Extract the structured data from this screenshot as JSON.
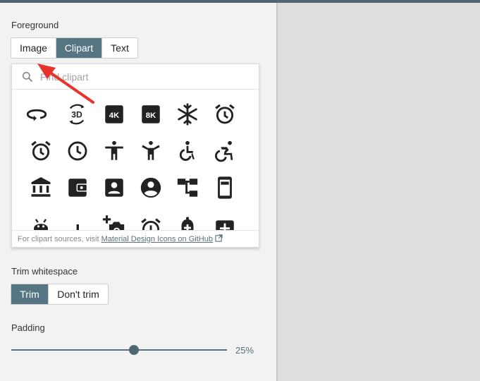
{
  "foreground": {
    "label": "Foreground",
    "tabs": [
      "Image",
      "Clipart",
      "Text"
    ],
    "active_tab": "Clipart"
  },
  "clipart": {
    "search_placeholder": "Find clipart",
    "icons": [
      "360-icon",
      "3d-rotation-icon",
      "4k-icon",
      "8k-icon",
      "ac-unit-icon",
      "access-alarm-icon",
      "access-alarms-icon",
      "access-time-icon",
      "accessibility-icon",
      "accessibility-new-icon",
      "accessible-icon",
      "accessible-forward-icon",
      "account-balance-icon",
      "account-balance-wallet-icon",
      "account-box-icon",
      "account-circle-icon",
      "account-tree-icon",
      "ad-units-icon",
      "adb-icon",
      "add-icon",
      "add-a-photo-icon",
      "add-alarm-icon",
      "add-alert-icon",
      "add-box-icon"
    ],
    "footer_text": "For clipart sources, visit ",
    "footer_link": "Material Design Icons on GitHub"
  },
  "trim": {
    "label": "Trim whitespace",
    "options": [
      "Trim",
      "Don't trim"
    ],
    "active": "Trim"
  },
  "padding": {
    "label": "Padding",
    "value_fraction": 0.57,
    "value_text": "25%"
  },
  "colors": {
    "accent": "#567583",
    "annotation_arrow": "#e8332a"
  }
}
